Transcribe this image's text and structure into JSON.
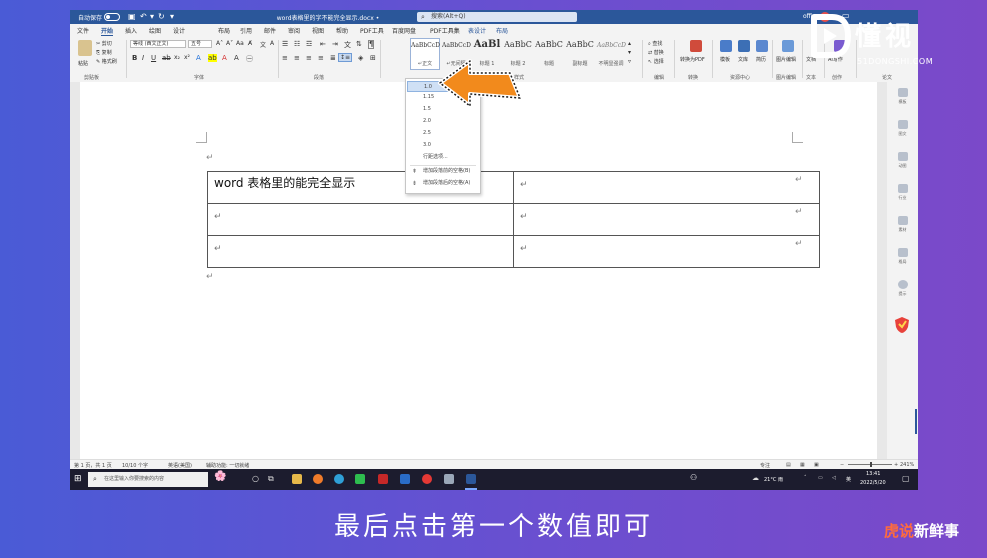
{
  "titlebar": {
    "autosave_label": "自动保存",
    "toggle_state": "关",
    "document_title": "word表格里的字不能完全显示.docx",
    "title_suffix": "•",
    "search_placeholder": "搜索(Alt+Q)",
    "user": "office"
  },
  "menu": {
    "tabs": [
      "文件",
      "开始",
      "插入",
      "绘图",
      "设计",
      "布局",
      "引用",
      "邮件",
      "审阅",
      "视图",
      "帮助",
      "PDF工具",
      "百度网盘",
      "PDF工具集",
      "表设计",
      "布局"
    ],
    "active": "开始"
  },
  "ribbon": {
    "clipboard": {
      "paste": "粘贴",
      "cut": "剪切",
      "copy": "复制",
      "format_painter": "格式刷",
      "group": "剪贴板"
    },
    "font": {
      "name": "等线 (西文正文)",
      "size": "五号",
      "group": "字体"
    },
    "paragraph": {
      "group": "段落"
    },
    "styles": {
      "items": [
        {
          "sample": "AaBbCcD",
          "name": "↵正文"
        },
        {
          "sample": "AaBbCcD",
          "name": "↵无间隔"
        },
        {
          "sample": "AaBl",
          "name": "标题 1"
        },
        {
          "sample": "AaBbC",
          "name": "标题 2"
        },
        {
          "sample": "AaBbC",
          "name": "标题"
        },
        {
          "sample": "AaBbC",
          "name": "副标题"
        },
        {
          "sample": "AaBbCcD",
          "name": "不明显强调"
        }
      ],
      "group": "样式"
    },
    "editing": {
      "find": "查找",
      "replace": "替换",
      "select": "选择",
      "group": "编辑"
    },
    "right_groups": [
      "转换为PDF",
      "模板",
      "文库",
      "简历",
      "图片编辑",
      "文档",
      "AI写作"
    ],
    "right_group_labels": [
      "转换",
      "资源中心",
      "图片编辑",
      "文本",
      "创作",
      "论文"
    ]
  },
  "line_spacing_menu": {
    "options": [
      "1.0",
      "1.15",
      "1.5",
      "2.0",
      "2.5",
      "3.0"
    ],
    "selected": "1.0",
    "more": "行距选项...",
    "add_before": "增加段落前的空格(B)",
    "add_after": "增加段落后的空格(A)"
  },
  "document": {
    "cell_text": "word 表格里的能完全显示",
    "para_mark": "↵"
  },
  "side_pane": {
    "items": [
      "模板",
      "图文",
      "动图",
      "行业",
      "素材",
      "格局",
      "提示"
    ]
  },
  "statusbar": {
    "page": "第 1 页，共 1 页",
    "words": "10/10 个字",
    "language": "英语(美国)",
    "accessibility": "辅助功能: 一切就绪",
    "focus": "专注",
    "zoom": "241%"
  },
  "taskbar": {
    "search_placeholder": "在这里输入你要搜索的内容",
    "temperature": "21°C 雨",
    "ime": "英",
    "time": "13:41",
    "date": "2022/5/20"
  },
  "overlay": {
    "brand_cn": "懂视",
    "brand_en": "51DONGSHI.COM",
    "subtitle": "最后点击第一个数值即可",
    "corner_a": "虎说",
    "corner_b": "新鲜事"
  },
  "colors": {
    "word_blue": "#2b579a",
    "arrow_orange": "#f28a1c",
    "background_left": "#4a5bd6",
    "background_right": "#7b49c9"
  }
}
